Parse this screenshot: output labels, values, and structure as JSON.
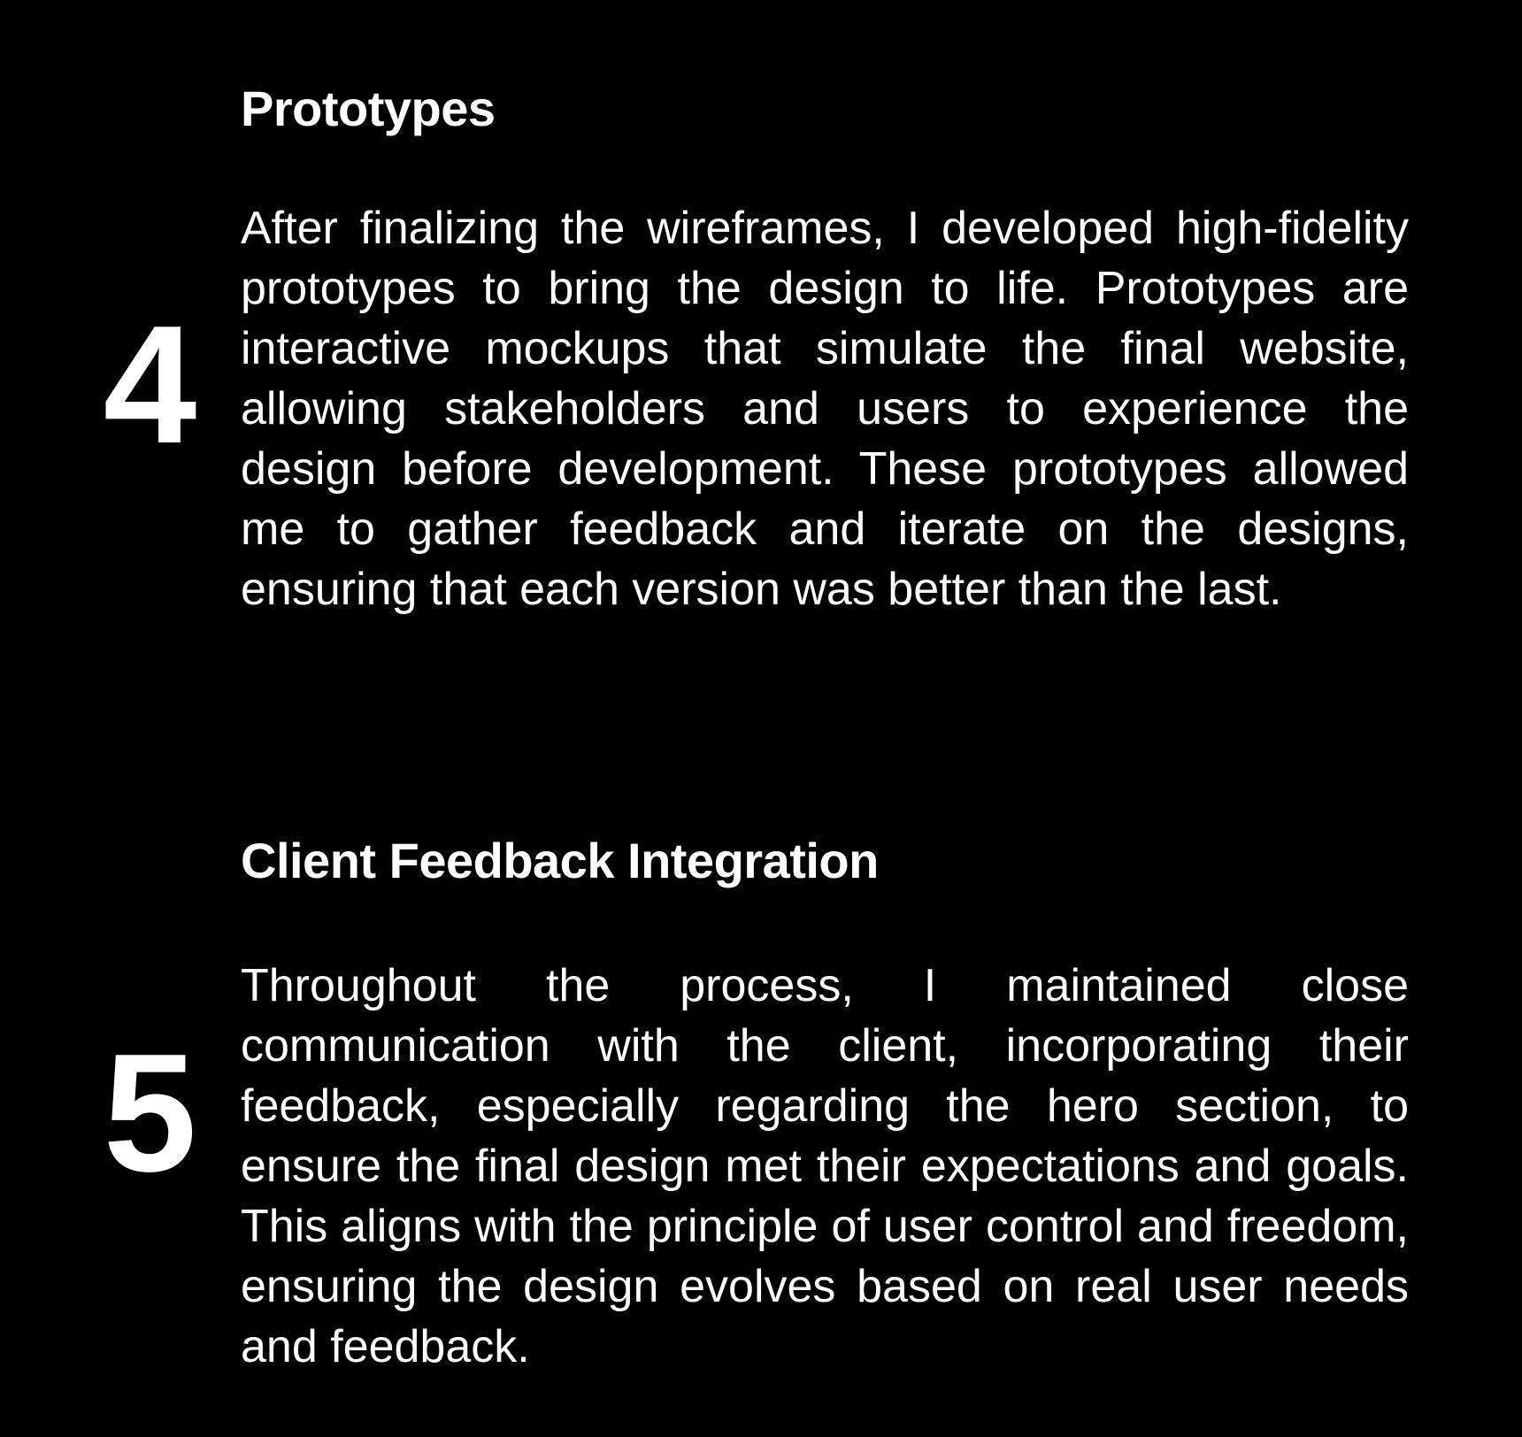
{
  "colors": {
    "background": "#000000",
    "text": "#ffffff"
  },
  "steps": [
    {
      "number": "4",
      "title": "Prototypes",
      "body": "After finalizing the wireframes, I developed high-fidelity prototypes to bring the design to life. Prototypes are interactive mockups that simulate the final website, allowing stakeholders and users to experience the design before development. These prototypes allowed me to gather feedback and iterate on the designs, ensuring that each version was better than the last."
    },
    {
      "number": "5",
      "title": "Client Feedback Integration",
      "body": "Throughout the process, I maintained close communication with the client, incorporating their feedback, especially regarding the hero section, to ensure the final design met their expectations and goals. This aligns with the principle of user control and freedom, ensuring the design evolves based on real user needs and feedback."
    }
  ]
}
